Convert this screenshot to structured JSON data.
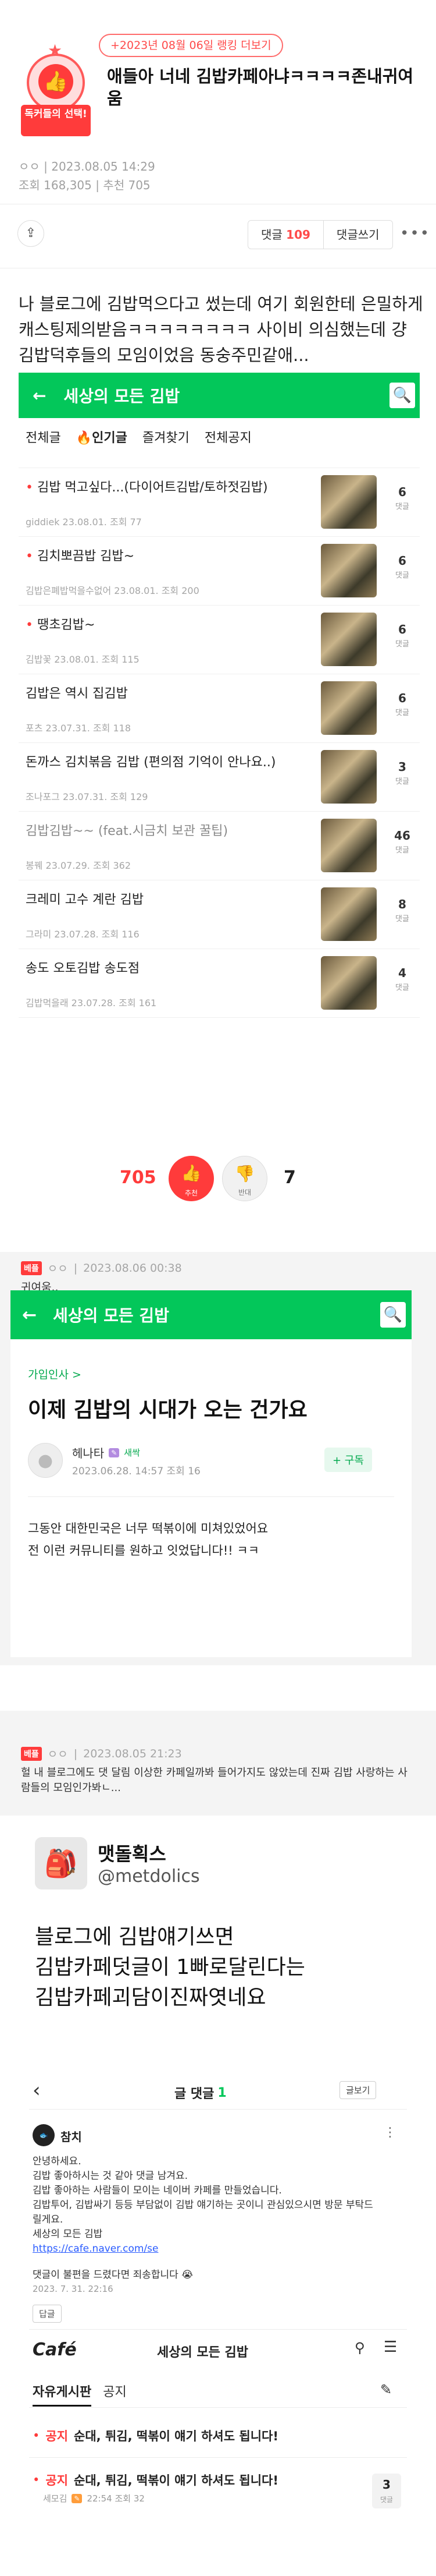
{
  "header": {
    "rank_pill": "+2023년 08월 06일 랭킹 더보기",
    "badge_label": "독커들의 선택!",
    "title": "애들아 너네 김밥카페아냐ㅋㅋㅋㅋ존내귀여움",
    "author_date": "ㅇㅇ | 2023.08.05 14:29",
    "stats": "조회 168,305 | 추천 705",
    "comment_label": "댓글",
    "comment_count": "109",
    "write_comment": "댓글쓰기",
    "more": "•••"
  },
  "body_text": "나 블로그에 김밥먹으다고 썼는데 여기 회원한테 은밀하게 캐스팅제의받음ㅋㅋㅋㅋㅋㅋㅋㅋ 사이비 의심했는데 걍 김밥덕후들의 모임이었음 동숭주민같애...",
  "cafe1": {
    "title": "세상의 모든 김밥",
    "tabs": [
      "전체글",
      "인기글",
      "즐겨찾기",
      "전체공지"
    ],
    "items": [
      {
        "title": "김밥 먹고싶다...(다이어트김밥/토하젓김밥)",
        "meta": "giddiek 23.08.01. 조회 77",
        "count": "6",
        "dot": true
      },
      {
        "title": "김치뽀끔밥 김밥~",
        "meta": "김밥은폐밥먹을수없어 23.08.01. 조회 200",
        "count": "6",
        "dot": true
      },
      {
        "title": "땡초김밥~",
        "meta": "김밥꽃 23.08.01. 조회 115",
        "count": "6",
        "dot": true
      },
      {
        "title": "김밥은 역시 집김밥",
        "meta": "포츠 23.07.31. 조회 118",
        "count": "6",
        "dot": false
      },
      {
        "title": "돈까스 김치볶음 김밥 (편의점 기억이 안나요..)",
        "meta": "조나포그 23.07.31. 조회 129",
        "count": "3",
        "dot": false
      },
      {
        "title": "김밥김밥~~ (feat.시금치 보관 꿀팁)",
        "meta": "봉꿰 23.07.29. 조회 362",
        "count": "46",
        "dot": false,
        "gray": true
      },
      {
        "title": "크레미 고수 계란 김밥",
        "meta": "그라미 23.07.28. 조회 116",
        "count": "8",
        "dot": false
      },
      {
        "title": "송도 오토김밥 송도점",
        "meta": "김밥먹을래 23.07.28. 조회 161",
        "count": "4",
        "dot": false
      }
    ],
    "count_unit": "댓글"
  },
  "votes": {
    "up": "705",
    "up_label": "추천",
    "down_label": "반대",
    "down": "7"
  },
  "comment1": {
    "best": "베플",
    "nick": "ㅇㅇ",
    "date": "2023.08.06 00:38",
    "text": "귀여움..",
    "cafe_title": "세상의 모든 김밥",
    "category": "가입인사 >",
    "post_title": "이제 김밥의 시대가 오는 건가요",
    "author": "헤나타",
    "author_badge": "새싹",
    "author_meta": "2023.06.28. 14:57 조회 16",
    "follow": "+ 구독",
    "post_body": "그동안 대한민국은 너무 떡볶이에 미쳐있었어요\n전 이런 커뮤니티를 원하고 잇었답니다!! ㅋㅋ"
  },
  "comment2": {
    "best": "베플",
    "nick": "ㅇㅇ",
    "date": "2023.08.05 21:23",
    "text": "헐 내 블로그에도 댓 달림 이상한 카페일까봐 들어가지도 않았는데 진짜 김밥 사랑하는 사람들의 모임인가봐ㄴ..."
  },
  "tweet": {
    "name": "맷돌획스",
    "handle": "@metdolics",
    "text": "블로그에 김밥얘기쓰면\n김밥카페덧글이 1빠로달린다는\n김밥카페괴담이진짜엿네요"
  },
  "cafe3": {
    "header_title": "글 댓글",
    "header_count": "1",
    "view_post": "글보기",
    "commenter": "참치",
    "comment_lines": [
      "안녕하세요.",
      "김밥 좋아하시는 것 같아 댓글 남겨요.",
      "김밥 좋아하는 사람들이 모이는 네이버 카페를 만들었습니다.",
      "김밥투어, 김밥싸기 등등 부담없이 김밥 얘기하는 곳이니 관심있으시면 방문 부탁드릴게요.",
      "세상의 모든 김밥"
    ],
    "link": "https://cafe.naver.com/se",
    "apology": "댓글이 불편을 드렸다면 죄송합니다 😭",
    "comment_date": "2023. 7. 31. 22:16",
    "reply": "답글",
    "cafe_logo": "Café",
    "cafe_name": "세상의 모든 김밥",
    "tab_active": "자유게시판",
    "tab_other": "공지",
    "notice_label": "공지",
    "notice_title": "순대, 튀김, 떡볶이 얘기 하셔도 됩니다!",
    "post_meta_nick": "세모김",
    "post_meta_time": "22:54 조회 32",
    "post_count": "3"
  },
  "colors": {
    "naver_green": "#03c75a",
    "accent_red": "#ff3b3b"
  }
}
